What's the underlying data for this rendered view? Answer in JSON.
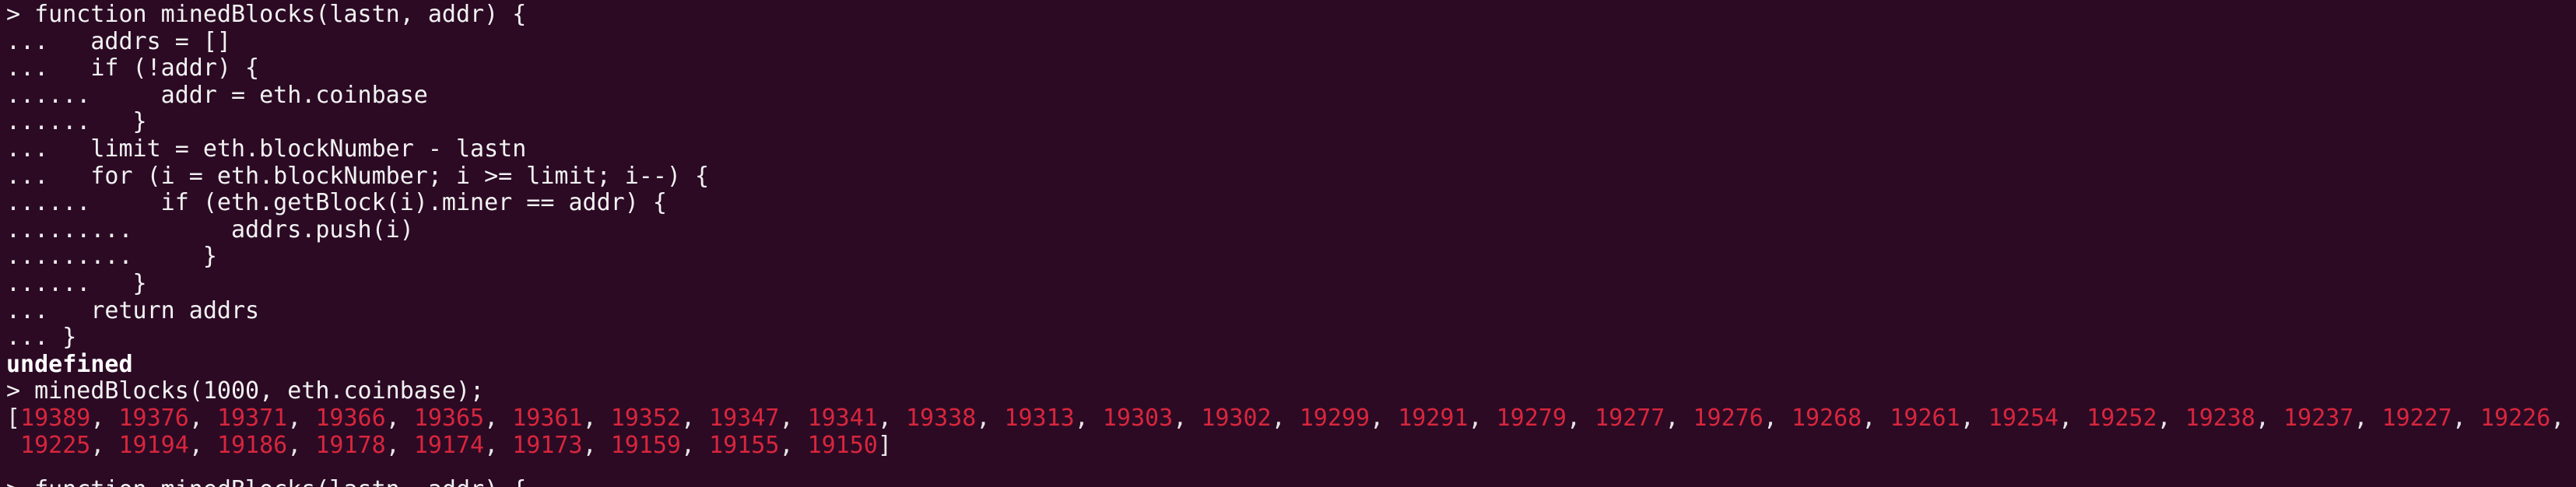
{
  "terminal": {
    "lines": [
      "> function minedBlocks(lastn, addr) {",
      "...   addrs = []",
      "...   if (!addr) {",
      "......     addr = eth.coinbase",
      "......   }",
      "...   limit = eth.blockNumber - lastn",
      "...   for (i = eth.blockNumber; i >= limit; i--) {",
      "......     if (eth.getBlock(i).miner == addr) {",
      ".........       addrs.push(i)",
      ".........     }",
      "......   }",
      "...   return addrs",
      "... }"
    ],
    "result_line": "undefined",
    "command_line": "> minedBlocks(1000, eth.coinbase);",
    "output_row1": [
      "19389",
      "19376",
      "19371",
      "19366",
      "19365",
      "19361",
      "19352",
      "19347",
      "19341",
      "19338",
      "19313",
      "19303",
      "19302",
      "19299",
      "19291",
      "19279",
      "19277",
      "19276",
      "19268",
      "19261",
      "19254",
      "19252",
      "19238",
      "19237",
      "19227",
      "19226"
    ],
    "output_row2": [
      "19225",
      "19194",
      "19186",
      "19178",
      "19174",
      "19173",
      "19159",
      "19155",
      "19150"
    ],
    "partial_line": "> function minedBlocks(lastn, addr) {"
  },
  "colors": {
    "background": "#2c0a24",
    "text": "#f2f2f2",
    "number": "#d7263d"
  }
}
